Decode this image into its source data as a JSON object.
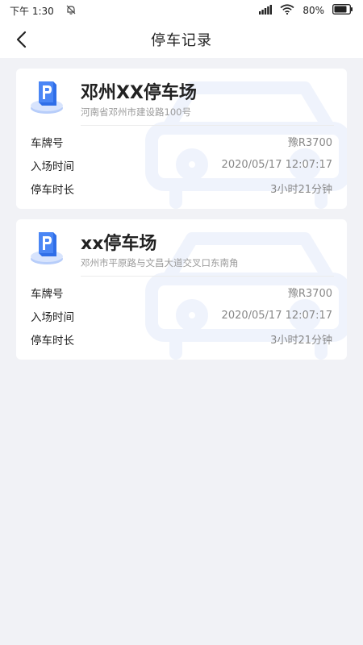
{
  "status_bar": {
    "time": "下午 1:30",
    "battery": "80%"
  },
  "header": {
    "title": "停车记录"
  },
  "records": [
    {
      "name": "邓州XX停车场",
      "address": "河南省邓州市建设路100号",
      "plate_label": "车牌号",
      "plate": "豫R3700",
      "entry_label": "入场时间",
      "entry_time": "2020/05/17 12:07:17",
      "duration_label": "停车时长",
      "duration": "3小时21分钟"
    },
    {
      "name": "xx停车场",
      "address": "邓州市平原路与文昌大道交叉口东南角",
      "plate_label": "车牌号",
      "plate": "豫R3700",
      "entry_label": "入场时间",
      "entry_time": "2020/05/17 12:07:17",
      "duration_label": "停车时长",
      "duration": "3小时21分钟"
    }
  ],
  "colors": {
    "accent": "#3a7bf2",
    "background": "#f1f2f6",
    "watermark": "#eef3ff"
  }
}
